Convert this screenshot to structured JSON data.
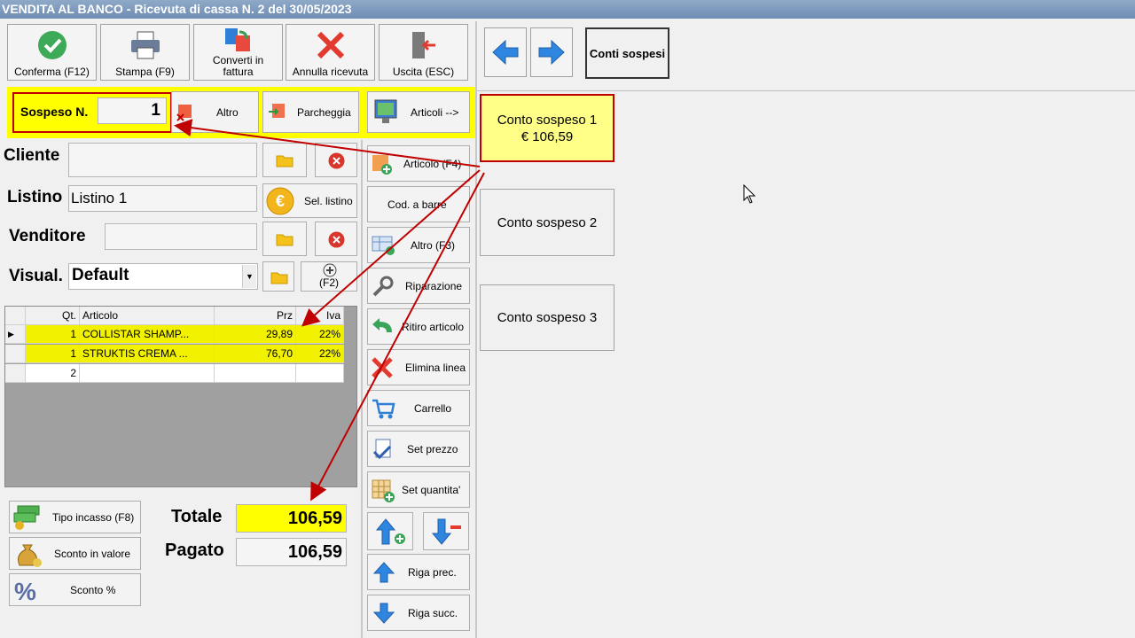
{
  "window": {
    "title": "VENDITA AL BANCO - Ricevuta di cassa N. 2 del 30/05/2023"
  },
  "toolbar": {
    "conferma": "Conferma (F12)",
    "stampa": "Stampa (F9)",
    "converti_l1": "Converti in",
    "converti_l2": "fattura",
    "annulla": "Annulla ricevuta",
    "uscita": "Uscita (ESC)",
    "conti_sospesi": "Conti sospesi"
  },
  "sospeso": {
    "label": "Sospeso N.",
    "value": "1",
    "altro": "Altro",
    "parcheggia": "Parcheggia",
    "articoli": "Articoli -->"
  },
  "form": {
    "cliente_label": "Cliente",
    "cliente_value": "",
    "listino_label": "Listino",
    "listino_value": "Listino 1",
    "sel_listino": "Sel. listino",
    "venditore_label": "Venditore",
    "venditore_value": "",
    "visual_label": "Visual.",
    "visual_value": "Default",
    "f2_label": "(F2)"
  },
  "table": {
    "headers": [
      "Qt.",
      "Articolo",
      "Prz",
      "Iva"
    ],
    "rows": [
      {
        "qt": "1",
        "articolo": "COLLISTAR SHAMP...",
        "prz": "29,89",
        "iva": "22%"
      },
      {
        "qt": "1",
        "articolo": "STRUKTIS CREMA ...",
        "prz": "76,70",
        "iva": "22%"
      },
      {
        "qt": "2",
        "articolo": "",
        "prz": "",
        "iva": ""
      }
    ]
  },
  "actions": {
    "articolo": "Articolo (F4)",
    "cod_barre": "Cod. a barre",
    "altro": "Altro (F3)",
    "riparazione": "Riparazione",
    "ritiro": "Ritiro articolo",
    "elimina": "Elimina linea",
    "carrello": "Carrello",
    "set_prezzo": "Set prezzo",
    "set_quantita": "Set quantita'",
    "riga_prec": "Riga prec.",
    "riga_succ": "Riga succ."
  },
  "payment": {
    "tipo_incasso": "Tipo incasso (F8)",
    "sconto_valore": "Sconto in valore",
    "sconto_perc": "Sconto %",
    "totale_label": "Totale",
    "totale_value": "106,59",
    "pagato_label": "Pagato",
    "pagato_value": "106,59"
  },
  "conti": [
    {
      "line1": "Conto sospeso 1",
      "line2": "€ 106,59"
    },
    {
      "line1": "Conto sospeso 2",
      "line2": ""
    },
    {
      "line1": "Conto sospeso 3",
      "line2": ""
    }
  ],
  "colors": {
    "highlight": "#ffff00",
    "annotation": "#c00000",
    "conto_active": "#ffff88",
    "row_yellow": "#f2f200"
  }
}
